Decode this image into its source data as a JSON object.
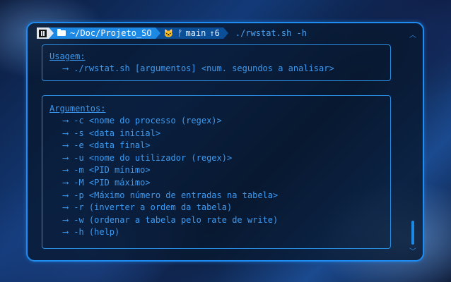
{
  "prompt": {
    "path": "~/Doc/Projeto_SO",
    "git_branch": "main",
    "git_ahead": "↑6",
    "command": "./rwstat.sh -h",
    "os_icon": "manjaro-icon",
    "folder_icon": "folder-icon",
    "git_icon": "github-cat-icon",
    "branch_icon": "branch-icon"
  },
  "usage": {
    "title": "Usagem:",
    "arrow": "⟶",
    "line": "./rwstat.sh [argumentos] <num. segundos a analisar>"
  },
  "arguments": {
    "title": "Argumentos:",
    "arrow": "⟶",
    "items": [
      "-c <nome do processo (regex)>",
      "-s <data inicial>",
      "-e <data final>",
      "-u <nome do utilizador (regex)>",
      "-m <PID mínimo>",
      "-M <PID máximo>",
      "-p <Máximo número de entradas na tabela>",
      "-r (inverter a ordem da tabela)",
      "-w (ordenar a tabela pelo rate de write)",
      "-h (help)"
    ]
  },
  "colors": {
    "accent": "#1e8cf0",
    "text": "#3d9af0",
    "segment_dir": "#1e88e5",
    "segment_git": "#0b4f99"
  },
  "scroll": {
    "position_fraction": 0.9
  }
}
